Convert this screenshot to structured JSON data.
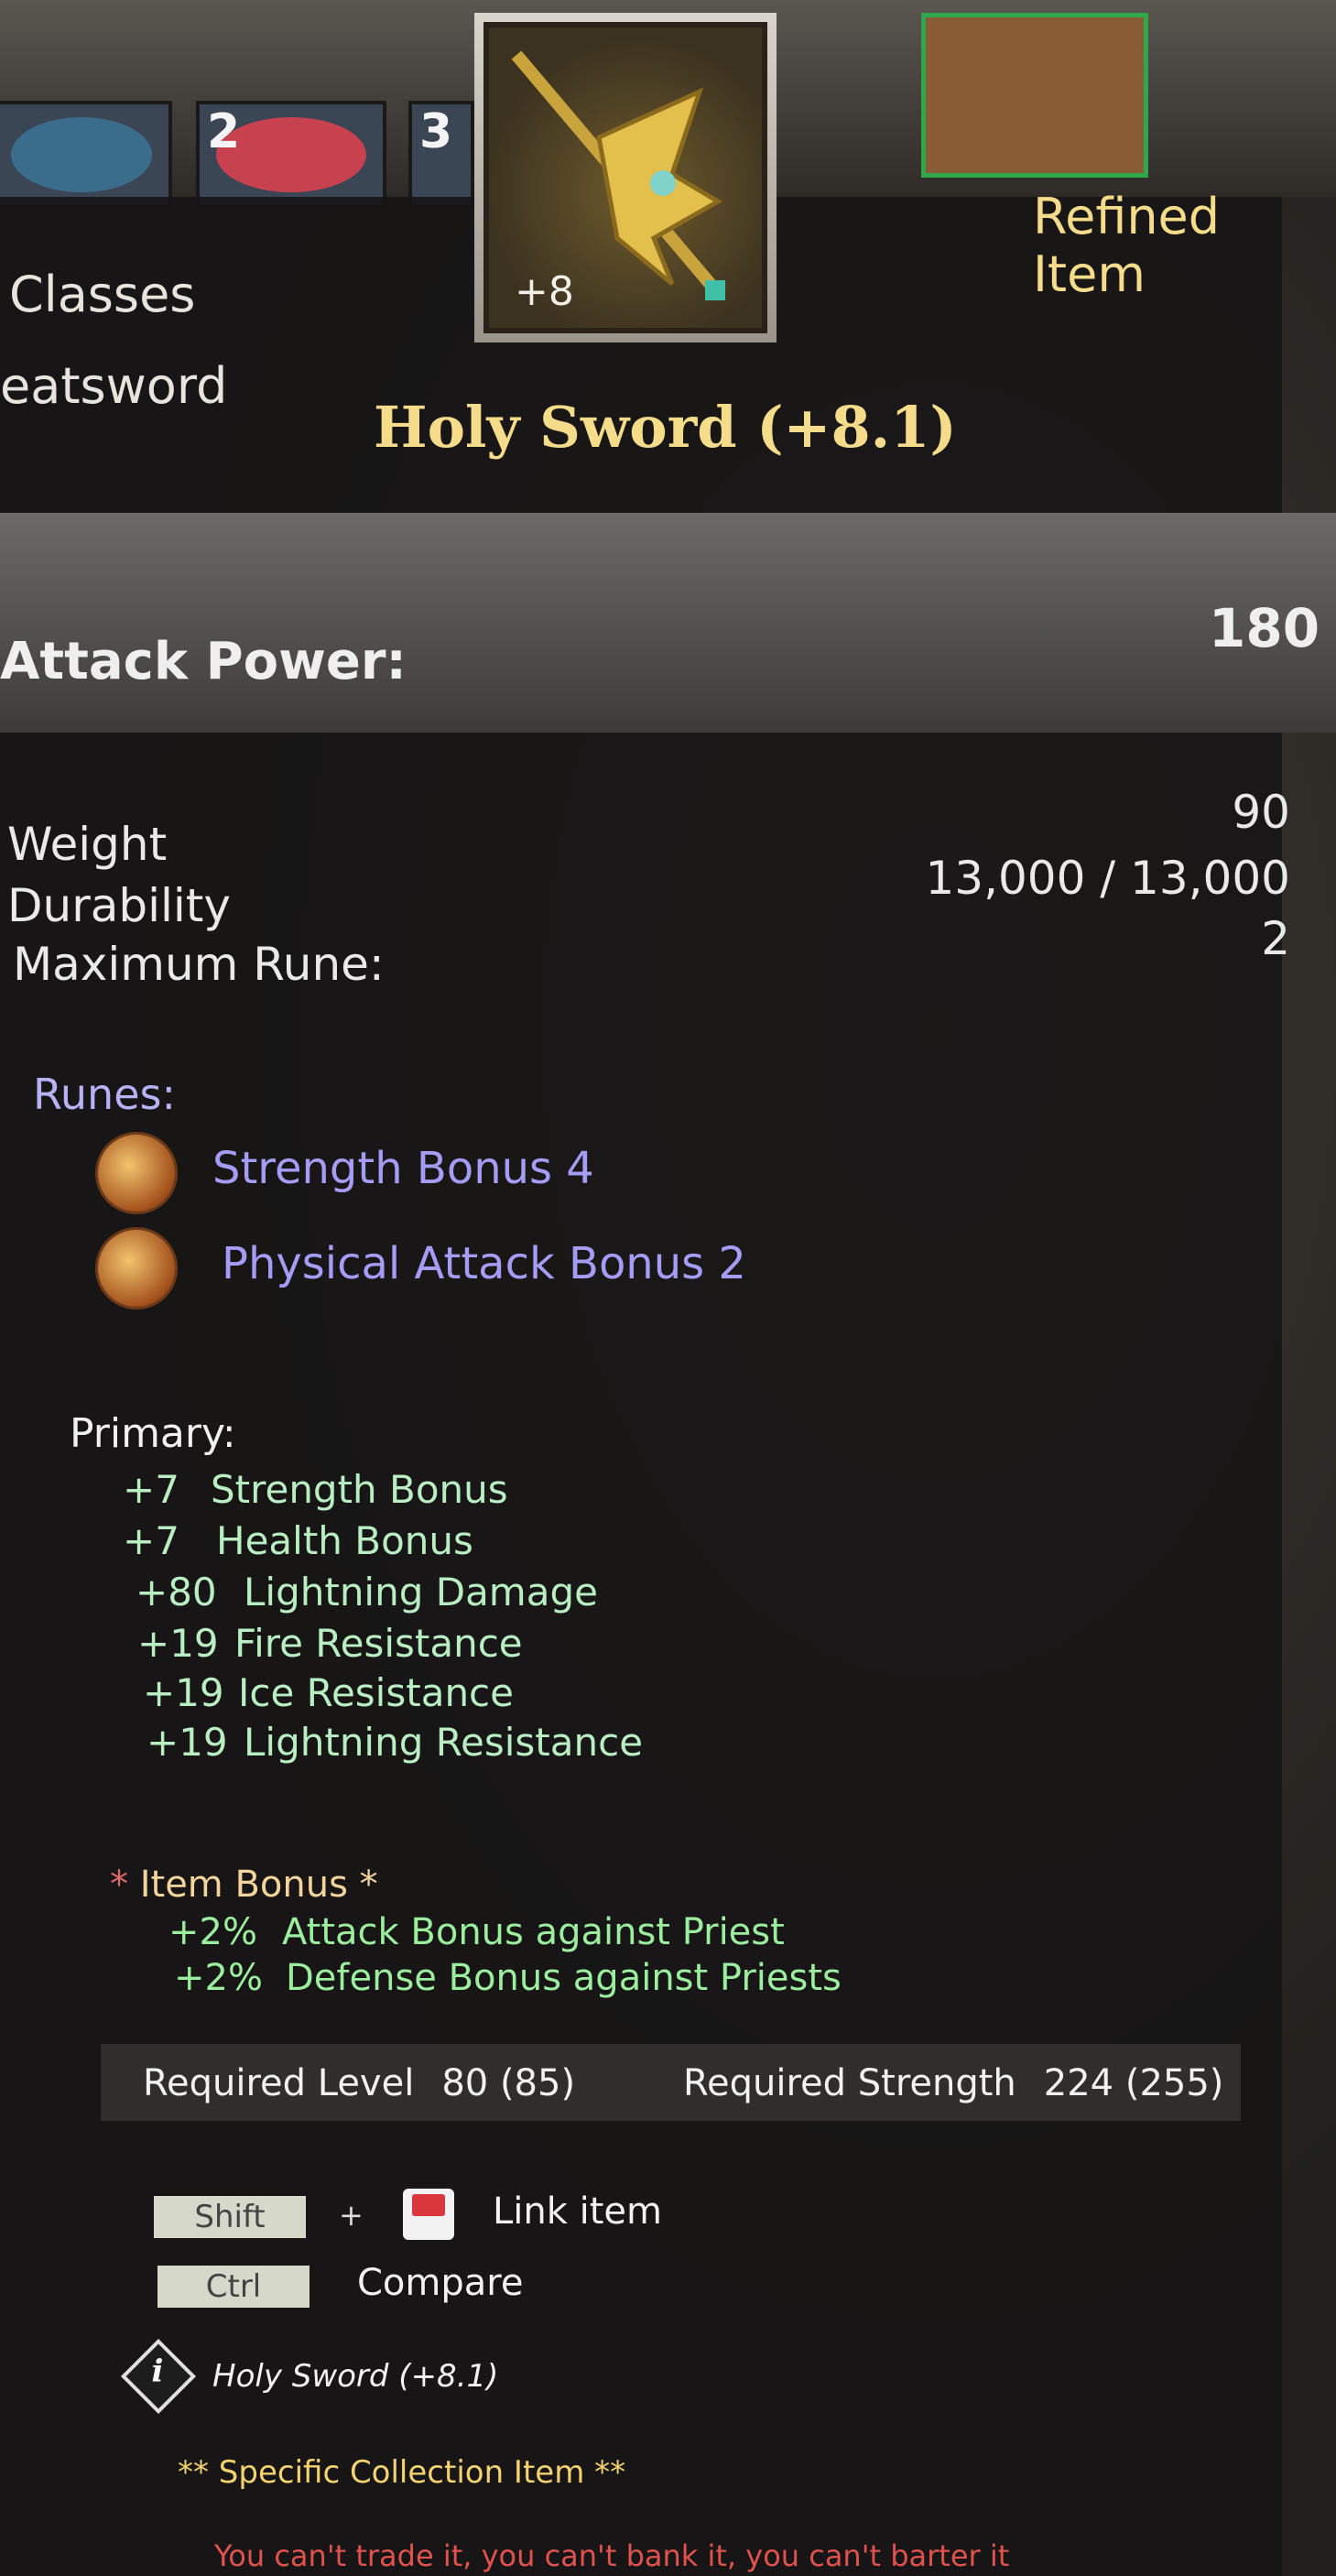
{
  "top_slots": [
    {
      "number": "",
      "color": "#3a6d8c"
    },
    {
      "number": "2",
      "color": "#c7424e"
    },
    {
      "number": "3",
      "color": "#3b4654"
    }
  ],
  "item": {
    "enhance_badge": "+8",
    "name": "Holy Sword (+8.1)",
    "tier_label": "Refined Item"
  },
  "header": {
    "classes_label": "Classes",
    "class_value": "eatsword"
  },
  "attack_power": {
    "label": "Attack Power:",
    "value": "180"
  },
  "stats": [
    {
      "label": "Weight",
      "value": "90"
    },
    {
      "label": "Durability",
      "value": "13,000 / 13,000"
    },
    {
      "label": "Maximum Rune:",
      "value": "2"
    }
  ],
  "runes": {
    "title": "Runes:",
    "items": [
      {
        "name": "Strength Bonus 4",
        "icon": "strength-rune-icon"
      },
      {
        "name": "Physical Attack Bonus 2",
        "icon": "attack-rune-icon"
      }
    ]
  },
  "primary": {
    "title": "Primary:",
    "rows": [
      {
        "value": "+7",
        "name": "Strength Bonus"
      },
      {
        "value": "+7",
        "name": "Health Bonus"
      },
      {
        "value": "+80",
        "name": "Lightning Damage"
      },
      {
        "value": "+19",
        "name": "Fire Resistance"
      },
      {
        "value": "+19",
        "name": "Ice Resistance"
      },
      {
        "value": "+19",
        "name": "Lightning Resistance"
      }
    ]
  },
  "item_bonus": {
    "star": "*",
    "title": "Item Bonus",
    "rows": [
      {
        "value": "+2%",
        "name": "Attack Bonus against Priest"
      },
      {
        "value": "+2%",
        "name": "Defense Bonus against Priests"
      }
    ]
  },
  "requirements": {
    "level_label": "Required Level",
    "level_value": "80 (85)",
    "strength_label": "Required Strength",
    "strength_value": "224 (255)"
  },
  "actions": {
    "shift_key": "Shift",
    "plus": "+",
    "link_label": "Link item",
    "ctrl_key": "Ctrl",
    "compare_label": "Compare"
  },
  "footer": {
    "info_glyph": "i",
    "item_name": "Holy Sword (+8.1)",
    "collection": "** Specific Collection Item **",
    "warning": "You can't trade it, you can't bank it, you can't barter it"
  },
  "colors": {
    "gold": "#f4dc8a",
    "rune_purple": "#a49cf5",
    "stat_green": "#b8eec1",
    "bonus_green": "#9cee9f",
    "warning_red": "#e0524e"
  }
}
